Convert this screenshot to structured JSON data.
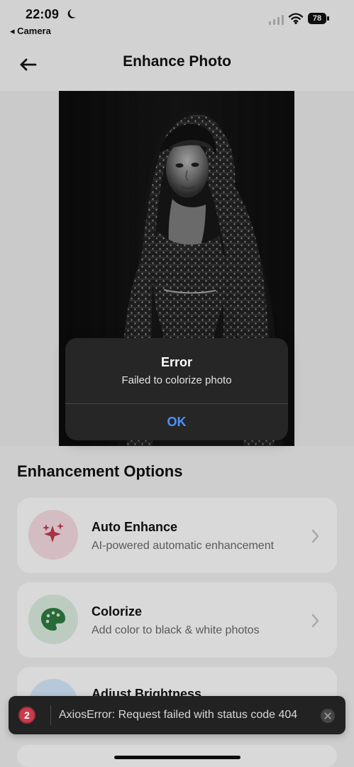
{
  "status_bar": {
    "time": "22:09",
    "back_app": "◂ Camera",
    "battery": "78",
    "icons": [
      "moon-icon",
      "signal-icon",
      "wifi-icon",
      "battery-icon"
    ]
  },
  "nav": {
    "title": "Enhance Photo",
    "back_icon": "arrow-left-icon"
  },
  "section": {
    "title": "Enhancement Options"
  },
  "options": [
    {
      "title": "Auto Enhance",
      "description": "AI-powered automatic enhancement",
      "icon": "sparkles-icon",
      "icon_bg": "#f8dfe4",
      "icon_color": "#c33a4e"
    },
    {
      "title": "Colorize",
      "description": "Add color to black & white photos",
      "icon": "palette-icon",
      "icon_bg": "#dff0e2",
      "icon_color": "#2f7d42"
    },
    {
      "title": "Adjust Brightness",
      "description": "",
      "icon": "brightness-icon",
      "icon_bg": "#d8ecff",
      "icon_color": "#2d87e8"
    }
  ],
  "alert": {
    "title": "Error",
    "message": "Failed to colorize photo",
    "ok_label": "OK"
  },
  "toast": {
    "count": "2",
    "message": "AxiosError: Request failed with status code 404",
    "close_icon": "close-circle-icon"
  },
  "colors": {
    "accent": "#4c92ff",
    "toast_badge": "#c73d4d",
    "overlay_dark": "#262626"
  }
}
